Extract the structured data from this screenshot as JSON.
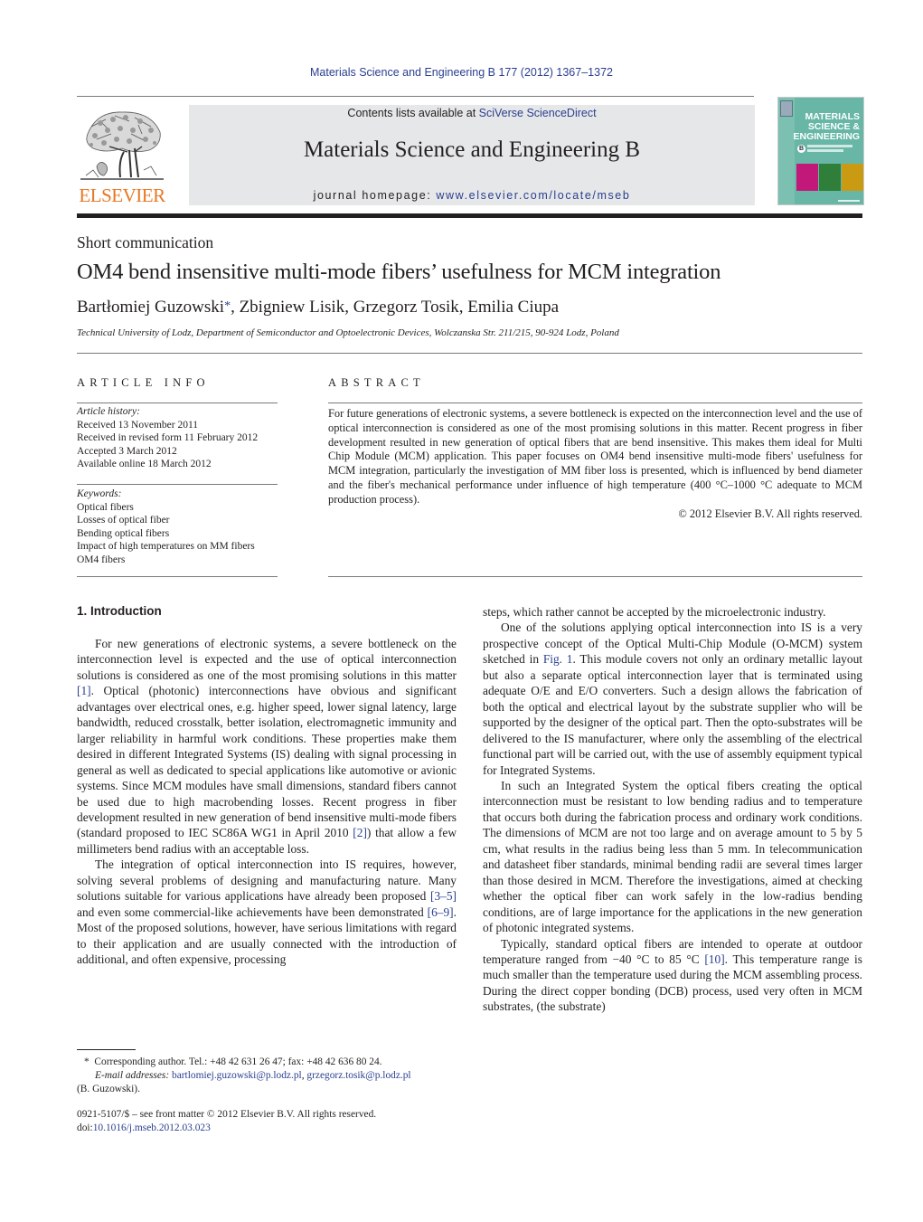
{
  "header": {
    "citation": "Materials Science and Engineering B 177 (2012) 1367–1372",
    "contents_prefix": "Contents lists available at ",
    "contents_link": "SciVerse ScienceDirect",
    "journal_title": "Materials Science and Engineering B",
    "homepage_prefix": "journal homepage: ",
    "homepage_link": "www.elsevier.com/locate/mseb",
    "publisher_logo_text": "ELSEVIER",
    "cover": {
      "line1": "MATERIALS",
      "line2": "SCIENCE &",
      "line3": "ENGINEERING",
      "letter": "B",
      "colors": [
        "#c2187a",
        "#2f7f3a",
        "#c99a12"
      ]
    }
  },
  "article": {
    "type": "Short communication",
    "title": "OM4 bend insensitive multi-mode fibers’ usefulness for MCM integration",
    "authors": [
      {
        "name": "Bartłomiej Guzowski",
        "corresponding": true
      },
      {
        "name": "Zbigniew Lisik"
      },
      {
        "name": "Grzegorz Tosik"
      },
      {
        "name": "Emilia Ciupa"
      }
    ],
    "author_sep": ", ",
    "star": "*",
    "affiliation": "Technical University of Lodz, Department of Semiconductor and Optoelectronic Devices, Wolczanska Str. 211/215, 90-924 Lodz, Poland"
  },
  "article_info": {
    "heading": "ARTICLE INFO",
    "history_label": "Article history:",
    "history": [
      "Received 13 November 2011",
      "Received in revised form 11 February 2012",
      "Accepted 3 March 2012",
      "Available online 18 March 2012"
    ],
    "keywords_label": "Keywords:",
    "keywords": [
      "Optical fibers",
      "Losses of optical fiber",
      "Bending optical fibers",
      "Impact of high temperatures on MM fibers",
      "OM4 fibers"
    ]
  },
  "abstract": {
    "heading": "ABSTRACT",
    "text": "For future generations of electronic systems, a severe bottleneck is expected on the interconnection level and the use of optical interconnection is considered as one of the most promising solutions in this matter. Recent progress in fiber development resulted in new generation of optical fibers that are bend insensitive. This makes them ideal for Multi Chip Module (MCM) application. This paper focuses on OM4 bend insensitive multi-mode fibers' usefulness for MCM integration, particularly the investigation of MM fiber loss is presented, which is influenced by bend diameter and the fiber's mechanical performance under influence of high temperature (400 °C–1000 °C adequate to MCM production process).",
    "copyright": "© 2012 Elsevier B.V. All rights reserved."
  },
  "body": {
    "section_heading": "1.  Introduction",
    "left_paragraphs": [
      {
        "segments": [
          {
            "t": "For new generations of electronic systems, a severe bottleneck on the interconnection level is expected and the use of optical interconnection solutions is considered as one of the most promising solutions in this matter "
          },
          {
            "t": "[1]",
            "link": true
          },
          {
            "t": ". Optical (photonic) interconnections have obvious and significant advantages over electrical ones, e.g. higher speed, lower signal latency, large bandwidth, reduced crosstalk, better isolation, electromagnetic immunity and larger reliability in harmful work conditions. These properties make them desired in different Integrated Systems (IS) dealing with signal processing in general as well as dedicated to special applications like automotive or avionic systems. Since MCM modules have small dimensions, standard fibers cannot be used due to high macrobending losses. Recent progress in fiber development resulted in new generation of bend insensitive multi-mode fibers (standard proposed to IEC SC86A WG1 in April 2010 "
          },
          {
            "t": "[2]",
            "link": true
          },
          {
            "t": ") that allow a few millimeters bend radius with an acceptable loss."
          }
        ]
      },
      {
        "segments": [
          {
            "t": "The integration of optical interconnection into IS requires, however, solving several problems of designing and manufacturing nature. Many solutions suitable for various applications have already been proposed "
          },
          {
            "t": "[3–5]",
            "link": true
          },
          {
            "t": " and even some commercial-like achievements have been demonstrated "
          },
          {
            "t": "[6–9]",
            "link": true
          },
          {
            "t": ". Most of the proposed solutions, however, have serious limitations with regard to their application and are usually connected with the introduction of additional, and often expensive, processing"
          }
        ]
      }
    ],
    "right_paragraphs": [
      {
        "noindent": true,
        "segments": [
          {
            "t": "steps, which rather cannot be accepted by the microelectronic industry."
          }
        ]
      },
      {
        "segments": [
          {
            "t": "One of the solutions applying optical interconnection into IS is a very prospective concept of the Optical Multi-Chip Module (O-MCM) system sketched in "
          },
          {
            "t": "Fig. 1",
            "link": true
          },
          {
            "t": ". This module covers not only an ordinary metallic layout but also a separate optical interconnection layer that is terminated using adequate O/E and E/O converters. Such a design allows the fabrication of both the optical and electrical layout by the substrate supplier who will be supported by the designer of the optical part. Then the opto-substrates will be delivered to the IS manufacturer, where only the assembling of the electrical functional part will be carried out, with the use of assembly equipment typical for Integrated Systems."
          }
        ]
      },
      {
        "segments": [
          {
            "t": "In such an Integrated System the optical fibers creating the optical interconnection must be resistant to low bending radius and to temperature that occurs both during the fabrication process and ordinary work conditions. The dimensions of MCM are not too large and on average amount to 5 by 5 cm, what results in the radius being less than 5 mm. In telecommunication and datasheet fiber standards, minimal bending radii are several times larger than those desired in MCM. Therefore the investigations, aimed at checking whether the optical fiber can work safely in the low-radius bending conditions, are of large importance for the applications in the new generation of photonic integrated systems."
          }
        ]
      },
      {
        "segments": [
          {
            "t": "Typically, standard optical fibers are intended to operate at outdoor temperature ranged from −40 °C to 85 °C "
          },
          {
            "t": "[10]",
            "link": true
          },
          {
            "t": ". This temperature range is much smaller than the temperature used during the MCM assembling process. During the direct copper bonding (DCB) process, used very often in MCM substrates, (the substrate)"
          }
        ]
      }
    ]
  },
  "footnote": {
    "star": "*",
    "corresponding": "Corresponding author. Tel.: +48 42 631 26 47; fax: +48 42 636 80 24.",
    "email_label": "E-mail addresses:",
    "emails": [
      "bartlomiej.guzowski@p.lodz.pl",
      "grzegorz.tosik@p.lodz.pl"
    ],
    "email_sep": ", ",
    "email_owner": "(B. Guzowski).",
    "issn": "0921-5107/$ – see front matter © 2012 Elsevier B.V. All rights reserved.",
    "doi_prefix": "doi:",
    "doi": "10.1016/j.mseb.2012.03.023"
  },
  "colors": {
    "link": "#2a3f8f",
    "elsevier_orange": "#e87722",
    "masthead_bg": "#e6e7e8",
    "cover_teal": "#67b6a6"
  }
}
